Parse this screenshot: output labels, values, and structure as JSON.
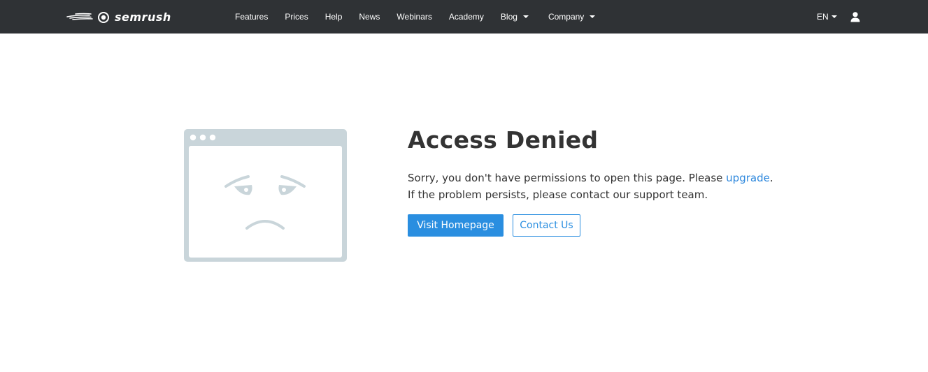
{
  "brand": {
    "name": "semrush",
    "logo_icon": "semrush-fireball-icon"
  },
  "nav": {
    "items": [
      {
        "label": "Features"
      },
      {
        "label": "Prices"
      },
      {
        "label": "Help"
      },
      {
        "label": "News"
      },
      {
        "label": "Webinars"
      },
      {
        "label": "Academy"
      }
    ],
    "dropdowns": [
      {
        "label": "Blog"
      },
      {
        "label": "Company"
      }
    ],
    "language": "EN",
    "user_icon": "user-icon"
  },
  "error": {
    "title": "Access Denied",
    "message_part1": "Sorry, you don't have permissions to open this page. Please ",
    "link_label": "upgrade",
    "message_part2": ".",
    "message_line2": "If the problem persists, please contact our support team.",
    "illustration_icon": "sad-browser-window-icon"
  },
  "actions": {
    "primary_label": "Visit Homepage",
    "secondary_label": "Contact Us"
  },
  "colors": {
    "navbar_bg": "#2f3235",
    "accent": "#2a8ee0",
    "illustration": "#c9d5da"
  }
}
